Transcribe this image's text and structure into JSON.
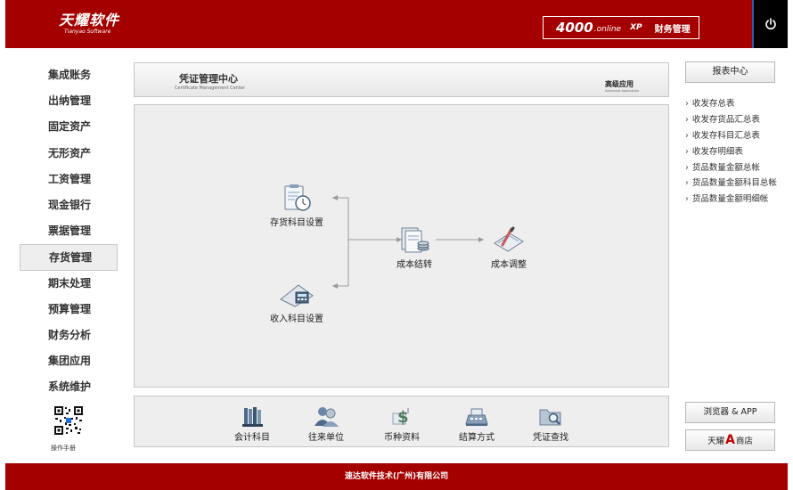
{
  "header": {
    "logo_main": "天耀软件",
    "logo_sub": "Tianyao Software",
    "edition_number": "4000",
    "edition_online": ".online",
    "edition_xp": "XP",
    "edition_name": "财务管理"
  },
  "sidebar": {
    "items": [
      {
        "label": "集成账务"
      },
      {
        "label": "出纳管理"
      },
      {
        "label": "固定资产"
      },
      {
        "label": "无形资产"
      },
      {
        "label": "工资管理"
      },
      {
        "label": "现金银行"
      },
      {
        "label": "票据管理"
      },
      {
        "label": "存货管理",
        "active": true
      },
      {
        "label": "期末处理"
      },
      {
        "label": "预算管理"
      },
      {
        "label": "财务分析"
      },
      {
        "label": "集团应用"
      },
      {
        "label": "系统维护"
      }
    ],
    "manual_label": "操作手册"
  },
  "title_bar": {
    "title": "凭证管理中心",
    "subtitle": "Certificate Management Center",
    "advanced": "高级应用",
    "advanced_en": "Advanced Application"
  },
  "flow": {
    "inventory_subject": "存货科目设置",
    "income_subject": "收入科目设置",
    "cost_transfer": "成本结转",
    "cost_adjust": "成本调整"
  },
  "toolbar": {
    "items": [
      {
        "label": "会计科目",
        "icon": "ledger-binders-icon"
      },
      {
        "label": "往来单位",
        "icon": "people-icon"
      },
      {
        "label": "币种资料",
        "icon": "currency-icon"
      },
      {
        "label": "结算方式",
        "icon": "cash-register-icon"
      },
      {
        "label": "凭证查找",
        "icon": "folder-search-icon"
      }
    ]
  },
  "right_panel": {
    "report_center": "报表中心",
    "reports": [
      "收发存总表",
      "收发存货品汇总表",
      "收发存科目汇总表",
      "收发存明细表",
      "货品数量金额总帐",
      "货品数量金额科目总帐",
      "货品数量金额明细帐"
    ],
    "browser_app": "浏览器 & APP",
    "store_prefix": "天耀",
    "store_letter": "A",
    "store_suffix": "商店"
  },
  "footer": {
    "company": "速达软件技术(广州)有限公司"
  },
  "colors": {
    "brand_red": "#a50000",
    "panel_bg": "#eeeeee",
    "border": "#c6c6c6"
  }
}
